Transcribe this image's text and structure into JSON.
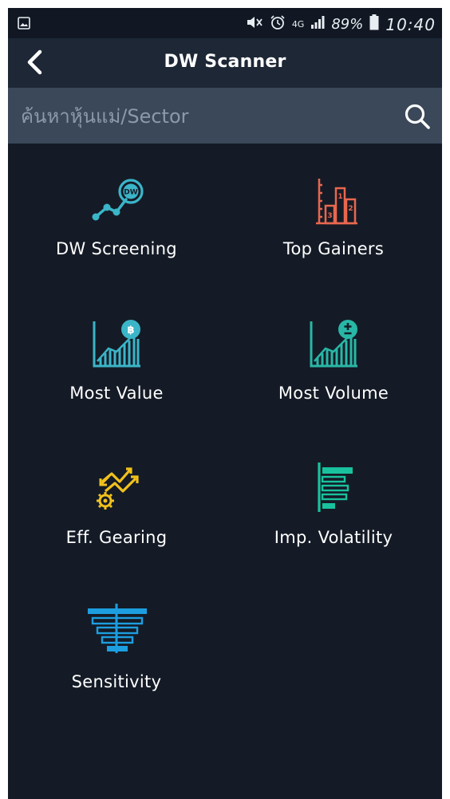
{
  "status_bar": {
    "time": "10:40",
    "battery": "89%",
    "network": "4G"
  },
  "header": {
    "title": "DW Scanner"
  },
  "search": {
    "placeholder": "ค้นหาหุ้นแม่/Sector",
    "value": ""
  },
  "menu": [
    {
      "label": "DW Screening",
      "icon": "dw-screening-icon",
      "color": "#3bb5c8"
    },
    {
      "label": "Top Gainers",
      "icon": "top-gainers-icon",
      "color": "#e9674f"
    },
    {
      "label": "Most Value",
      "icon": "most-value-icon",
      "color": "#3bb5c8"
    },
    {
      "label": "Most Volume",
      "icon": "most-volume-icon",
      "color": "#28b7a6"
    },
    {
      "label": "Eff. Gearing",
      "icon": "eff-gearing-icon",
      "color": "#f2c21b"
    },
    {
      "label": "Imp. Volatility",
      "icon": "imp-volatility-icon",
      "color": "#19c29e"
    },
    {
      "label": "Sensitivity",
      "icon": "sensitivity-icon",
      "color": "#1d9ee0"
    }
  ],
  "colors": {
    "background": "#141b26",
    "header": "#1d2736",
    "search_bar": "#3a4859"
  }
}
